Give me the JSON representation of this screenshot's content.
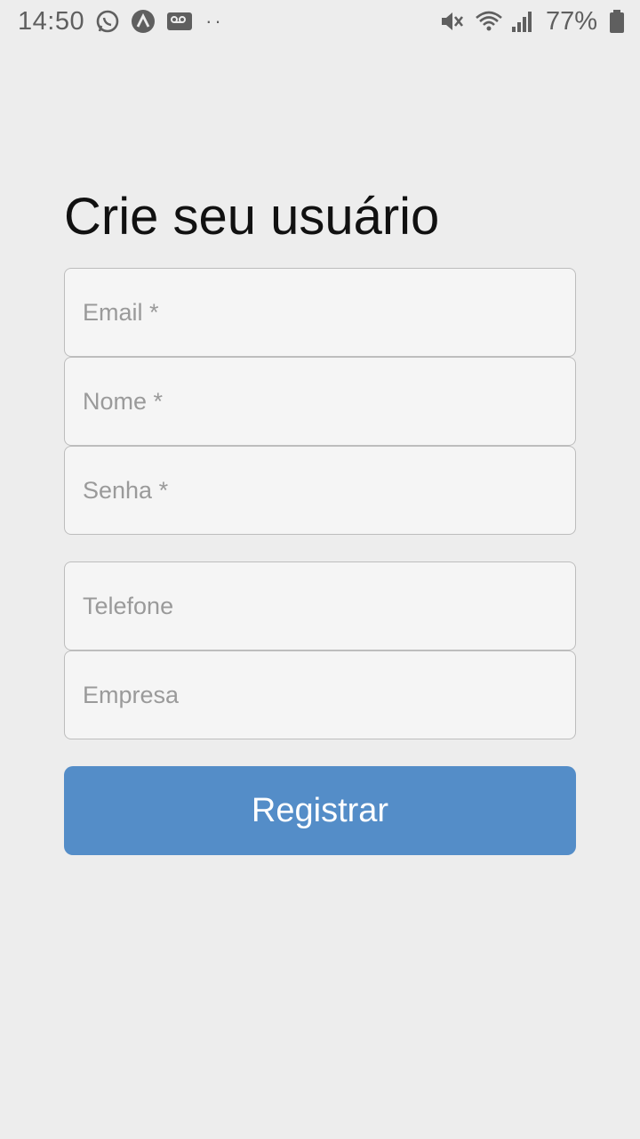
{
  "status_bar": {
    "time": "14:50",
    "battery_percent": "77%",
    "notification_icons": [
      "whatsapp-icon",
      "app-a-icon",
      "voicemail-icon",
      "more-dots-icon"
    ],
    "system_icons": [
      "mute-icon",
      "wifi-icon",
      "signal-icon",
      "battery-icon"
    ],
    "more_dots": "··"
  },
  "form": {
    "title": "Crie seu usuário",
    "fields": [
      {
        "placeholder": "Email *",
        "value": ""
      },
      {
        "placeholder": "Nome *",
        "value": ""
      },
      {
        "placeholder": "Senha *",
        "value": ""
      },
      {
        "placeholder": "Telefone",
        "value": ""
      },
      {
        "placeholder": "Empresa",
        "value": ""
      }
    ],
    "submit_label": "Registrar"
  },
  "colors": {
    "background": "#ededed",
    "button": "#548dc8",
    "field_background": "#f5f5f5",
    "field_border": "#bdbdbd"
  }
}
